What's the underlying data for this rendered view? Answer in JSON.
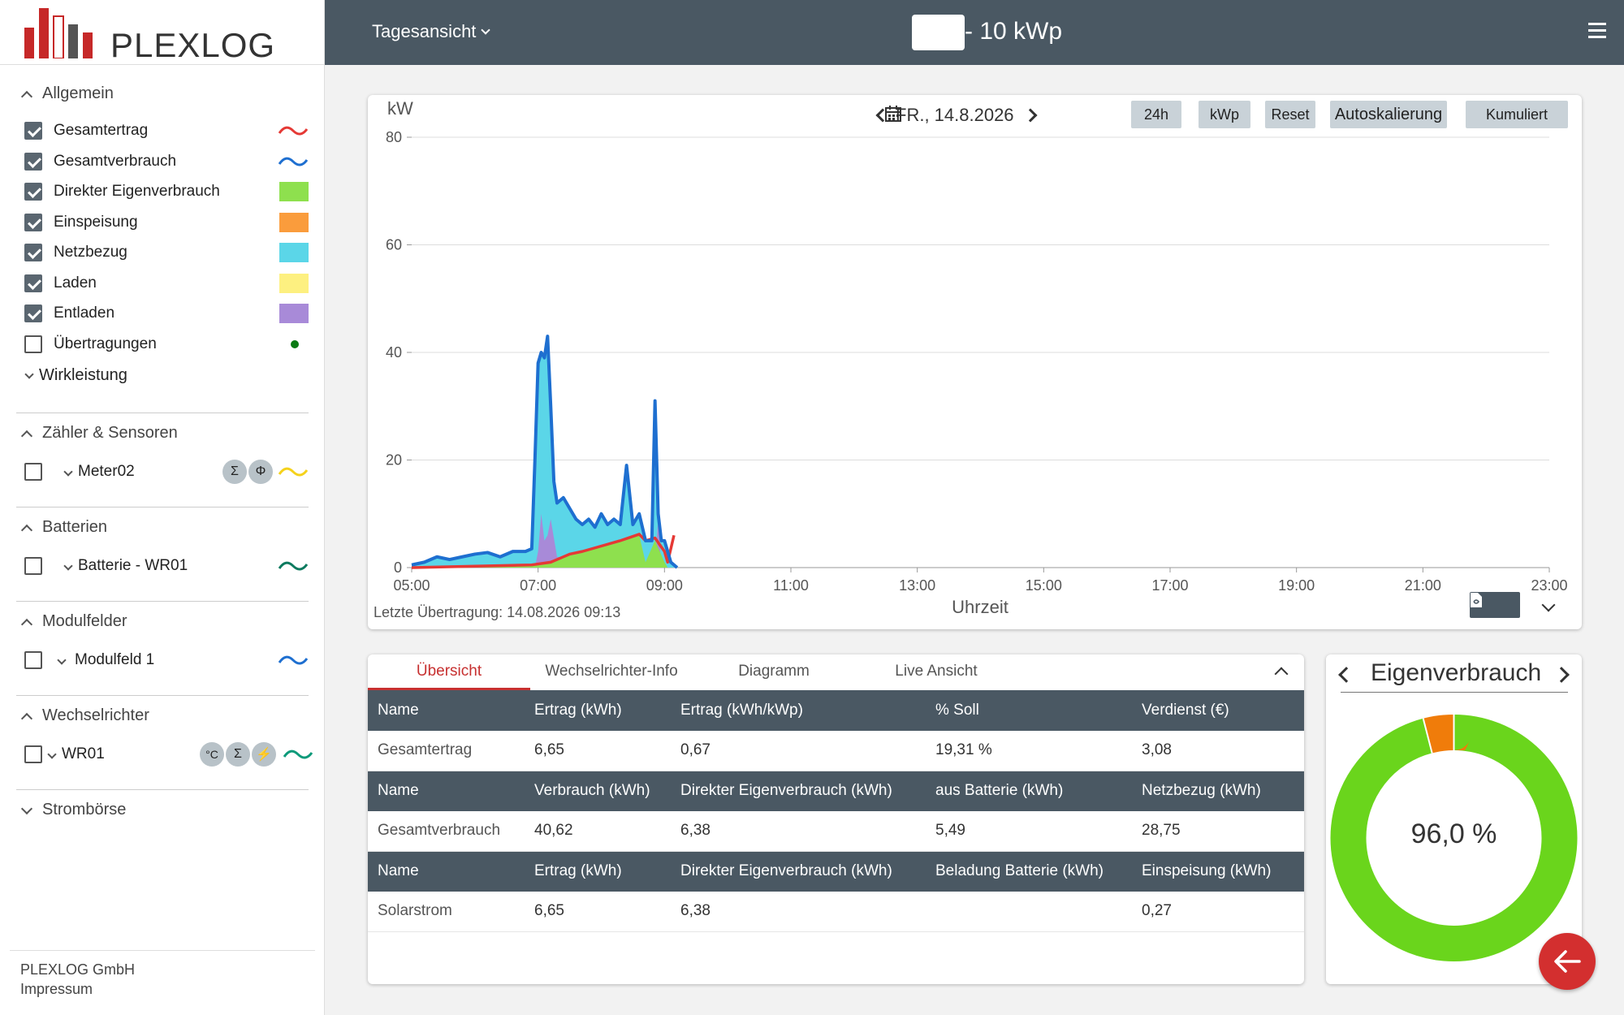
{
  "brand": {
    "name": "PLEXLOG",
    "company": "PLEXLOG GmbH",
    "impressum": "Impressum"
  },
  "topbar": {
    "view": "Tagesansicht",
    "plant_title": "- 10 kWp"
  },
  "sidebar": {
    "allgemein": {
      "title": "Allgemein",
      "items": [
        {
          "label": "Gesamtertrag",
          "checked": true,
          "legend": "wave",
          "color": "#e53935"
        },
        {
          "label": "Gesamtverbrauch",
          "checked": true,
          "legend": "wave",
          "color": "#1e6fd0"
        },
        {
          "label": "Direkter Eigenverbrauch",
          "checked": true,
          "legend": "swatch",
          "color": "#8ee04e"
        },
        {
          "label": "Einspeisung",
          "checked": true,
          "legend": "swatch",
          "color": "#fa9c3c"
        },
        {
          "label": "Netzbezug",
          "checked": true,
          "legend": "swatch",
          "color": "#5bd6e8"
        },
        {
          "label": "Laden",
          "checked": true,
          "legend": "swatch",
          "color": "#fdf080"
        },
        {
          "label": "Entladen",
          "checked": true,
          "legend": "swatch",
          "color": "#a88ad8"
        },
        {
          "label": "Übertragungen",
          "checked": false,
          "legend": "dot",
          "color": "#0b7a14"
        }
      ],
      "sub": "Wirkleistung"
    },
    "zaehler": {
      "title": "Zähler & Sensoren",
      "item": "Meter02",
      "badges": [
        "Σ",
        "Φ"
      ],
      "color": "#f5d21c"
    },
    "batterien": {
      "title": "Batterien",
      "item": "Batterie - WR01",
      "color": "#0d7a5f"
    },
    "modulfelder": {
      "title": "Modulfelder",
      "item": "Modulfeld 1",
      "color": "#1e6fd0"
    },
    "wechselrichter": {
      "title": "Wechselrichter",
      "item": "WR01",
      "badges": [
        "°C",
        "Σ",
        "⚡"
      ],
      "color": "#0d9a7a"
    },
    "stromboerse": {
      "title": "Strombörse"
    }
  },
  "chart": {
    "buttons": [
      "24h",
      "kWp",
      "Reset",
      "Autoskalierung",
      "Kumuliert"
    ],
    "date": "FR., 14.8.2026",
    "last_transfer": "Letzte Übertragung: 14.08.2026 09:13"
  },
  "chart_data": {
    "type": "area",
    "ylabel": "kW",
    "xlabel": "Uhrzeit",
    "ylim": [
      0,
      80
    ],
    "yticks": [
      0,
      20,
      40,
      60,
      80
    ],
    "xticks": [
      "05:00",
      "07:00",
      "09:00",
      "11:00",
      "13:00",
      "15:00",
      "17:00",
      "19:00",
      "21:00",
      "23:00"
    ],
    "xrange_hours": [
      5,
      23
    ],
    "series": [
      {
        "name": "Gesamtverbrauch",
        "color": "#1e6fd0",
        "x": [
          5.0,
          5.2,
          5.4,
          5.6,
          5.8,
          6.0,
          6.2,
          6.4,
          6.6,
          6.8,
          6.9,
          6.95,
          7.0,
          7.05,
          7.1,
          7.15,
          7.2,
          7.25,
          7.3,
          7.4,
          7.5,
          7.6,
          7.7,
          7.8,
          7.9,
          8.0,
          8.1,
          8.2,
          8.3,
          8.4,
          8.5,
          8.6,
          8.7,
          8.8,
          8.85,
          8.9,
          8.95,
          9.0,
          9.1,
          9.2
        ],
        "values": [
          0.5,
          1,
          2,
          1.5,
          2,
          2.5,
          2.8,
          2,
          3,
          3,
          3.5,
          20,
          38,
          40,
          39,
          43,
          30,
          16,
          12,
          13,
          11,
          9,
          8,
          9,
          7.5,
          10,
          8,
          9,
          8,
          19,
          8,
          10,
          5,
          5,
          31,
          10,
          5,
          5,
          1,
          0
        ]
      },
      {
        "name": "Gesamtertrag",
        "color": "#e53935",
        "x": [
          5.0,
          6.9,
          7.2,
          7.3,
          7.5,
          7.7,
          8.0,
          8.3,
          8.6,
          8.7,
          8.85,
          9.0,
          9.05,
          9.15
        ],
        "values": [
          0,
          0.5,
          1,
          1.5,
          2.5,
          3,
          4,
          5,
          6.2,
          5,
          5.5,
          3,
          1,
          6
        ]
      },
      {
        "name": "Direkter Eigenverbrauch",
        "color": "#8ee04e",
        "x": [
          5.0,
          6.9,
          7.2,
          7.3,
          7.5,
          7.7,
          8.0,
          8.3,
          8.6,
          8.7,
          8.85,
          9.0,
          9.05
        ],
        "values": [
          0,
          0.5,
          1,
          1.5,
          2.5,
          3,
          4,
          5,
          6,
          1,
          5,
          1,
          0
        ]
      },
      {
        "name": "Entladen",
        "color": "#a88ad8",
        "x": [
          6.95,
          7.0,
          7.05,
          7.1,
          7.15,
          7.2,
          7.3,
          8.85,
          8.9,
          8.95
        ],
        "values": [
          0,
          3,
          10,
          5,
          6,
          9,
          2,
          0,
          9,
          0
        ]
      }
    ]
  },
  "table": {
    "tabs": [
      "Übersicht",
      "Wechselrichter-Info",
      "Diagramm",
      "Live Ansicht"
    ],
    "groups": [
      {
        "headers": [
          "Name",
          "Ertrag (kWh)",
          "Ertrag (kWh/kWp)",
          "% Soll",
          "Verdienst (€)"
        ],
        "row": [
          "Gesamtertrag",
          "6,65",
          "0,67",
          "19,31 %",
          "3,08"
        ]
      },
      {
        "headers": [
          "Name",
          "Verbrauch (kWh)",
          "Direkter Eigenverbrauch (kWh)",
          "aus Batterie (kWh)",
          "Netzbezug (kWh)"
        ],
        "row": [
          "Gesamtverbrauch",
          "40,62",
          "6,38",
          "5,49",
          "28,75"
        ]
      },
      {
        "headers": [
          "Name",
          "Ertrag (kWh)",
          "Direkter Eigenverbrauch (kWh)",
          "Beladung Batterie (kWh)",
          "Einspeisung (kWh)"
        ],
        "row": [
          "Solarstrom",
          "6,65",
          "6,38",
          "",
          "0,27"
        ]
      }
    ]
  },
  "donut": {
    "title": "Eigenverbrauch",
    "value_label": "96,0 %",
    "fraction": 0.96,
    "color_main": "#6ad51c",
    "color_rest": "#f07c0a"
  }
}
